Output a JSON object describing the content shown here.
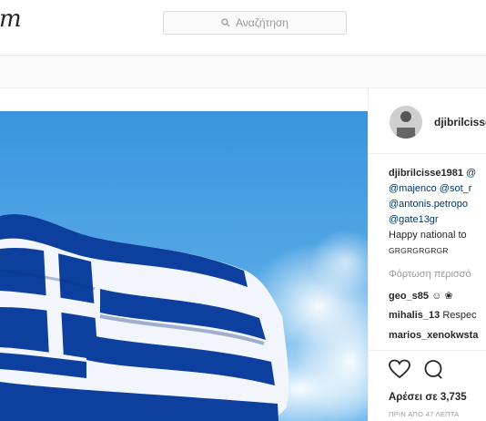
{
  "header": {
    "logo_fragment": "m",
    "search_placeholder": "Αναζήτηση"
  },
  "post": {
    "author": "djibrilcisse",
    "caption": {
      "author": "djibrilcisse1981",
      "line1_tail": "@",
      "line2": "@majenco @sot_r",
      "line3": "@antonis.petropo",
      "line4": "@gate13gr",
      "line5": "Happy national to",
      "line6": "GRGRGRGRGR"
    },
    "load_more": "Φόρτωση περισσό",
    "comments": [
      {
        "user": "geo_s85",
        "text": "☺ ❀"
      },
      {
        "user": "mihalis_13",
        "text": "Respec"
      },
      {
        "user": "marios_xenokwsta",
        "text": ""
      }
    ],
    "likes": "Αρέσει σε 3,735",
    "time": "ΠΡΙΝ ΑΠΟ 47 ΛΕΠΤΑ"
  },
  "icons": [
    "search-icon",
    "heart-icon",
    "comment-icon"
  ],
  "colors": {
    "flag_blue": "#0d3f9f",
    "sky": "#3f9fe0",
    "link": "#003569"
  }
}
